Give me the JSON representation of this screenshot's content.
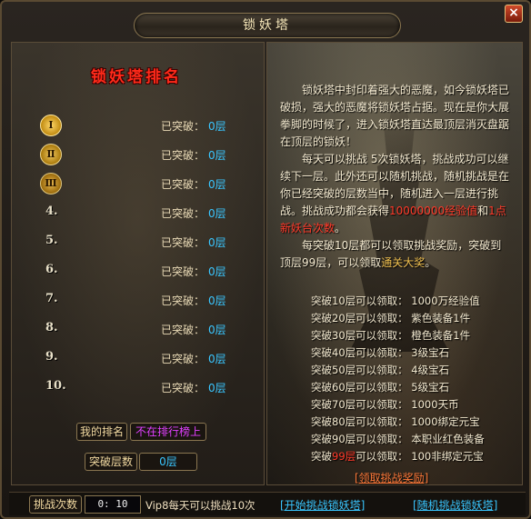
{
  "title": "锁妖塔",
  "close_label": "×",
  "ranking": {
    "title": "锁妖塔排名",
    "rows": [
      {
        "badge": "Ⅰ",
        "label": "已突破：",
        "value": "0层"
      },
      {
        "badge": "Ⅱ",
        "label": "已突破：",
        "value": "0层"
      },
      {
        "badge": "Ⅲ",
        "label": "已突破：",
        "value": "0层"
      },
      {
        "badge": "4.",
        "label": "已突破：",
        "value": "0层"
      },
      {
        "badge": "5.",
        "label": "已突破：",
        "value": "0层"
      },
      {
        "badge": "6.",
        "label": "已突破：",
        "value": "0层"
      },
      {
        "badge": "7.",
        "label": "已突破：",
        "value": "0层"
      },
      {
        "badge": "8.",
        "label": "已突破：",
        "value": "0层"
      },
      {
        "badge": "9.",
        "label": "已突破：",
        "value": "0层"
      },
      {
        "badge": "10.",
        "label": "已突破：",
        "value": "0层"
      }
    ],
    "my_rank_label": "我的排名",
    "my_rank_value": "不在排行榜上",
    "floors_label": "突破层数",
    "floors_value": "0层"
  },
  "description": {
    "p1": "锁妖塔中封印着强大的恶魔，如今锁妖塔已破损，强大的恶魔将锁妖塔占据。现在是你大展拳脚的时候了，进入锁妖塔直达最顶层消灭盘踞在顶层的锁妖！",
    "p2_a": "每天可以挑战 5次锁妖塔，挑战成功可以继续下一层。此外还可以随机挑战，随机挑战是在你已经突破的层数当中，随机进入一层进行挑战。挑战成功都会获得",
    "p2_hl1": "10000000经验值",
    "p2_and": "和",
    "p2_hl2": "1点新妖台次数",
    "p2_end": "。",
    "p3_a": "每突破10层都可以领取挑战奖励，突破到顶层99层，可以领取",
    "p3_hl": "通关大奖",
    "p3_end": "。"
  },
  "rewards": [
    {
      "prefix": "突破",
      "level": "10层",
      "suffix": "可以领取：",
      "item": "1000万经验值",
      "red": false
    },
    {
      "prefix": "突破",
      "level": "20层",
      "suffix": "可以领取：",
      "item": "紫色装备1件",
      "red": false
    },
    {
      "prefix": "突破",
      "level": "30层",
      "suffix": "可以领取：",
      "item": "橙色装备1件",
      "red": false
    },
    {
      "prefix": "突破",
      "level": "40层",
      "suffix": "可以领取：",
      "item": "3级宝石",
      "red": false
    },
    {
      "prefix": "突破",
      "level": "50层",
      "suffix": "可以领取：",
      "item": "4级宝石",
      "red": false
    },
    {
      "prefix": "突破",
      "level": "60层",
      "suffix": "可以领取：",
      "item": "5级宝石",
      "red": false
    },
    {
      "prefix": "突破",
      "level": "70层",
      "suffix": "可以领取：",
      "item": "1000天币",
      "red": false
    },
    {
      "prefix": "突破",
      "level": "80层",
      "suffix": "可以领取：",
      "item": "1000绑定元宝",
      "red": false
    },
    {
      "prefix": "突破",
      "level": "90层",
      "suffix": "可以领取：",
      "item": "本职业红色装备",
      "red": false
    },
    {
      "prefix": "突破",
      "level": "99层",
      "suffix": "可以领取：",
      "item": "100非绑定元宝",
      "red": true
    }
  ],
  "claim_label": "[领取挑战奖励]",
  "bottom": {
    "challenge_label": "挑战次数",
    "challenge_value": "0: 10",
    "vip_note": "Vip8每天可以挑战10次",
    "start_label": "[开始挑战锁妖塔]",
    "random_label": "[随机挑战锁妖塔]"
  },
  "colors": {
    "accent_blue": "#39c6ff",
    "accent_red": "#ff3a2a",
    "accent_purple": "#e040ff",
    "text_main": "#f4ead0"
  }
}
